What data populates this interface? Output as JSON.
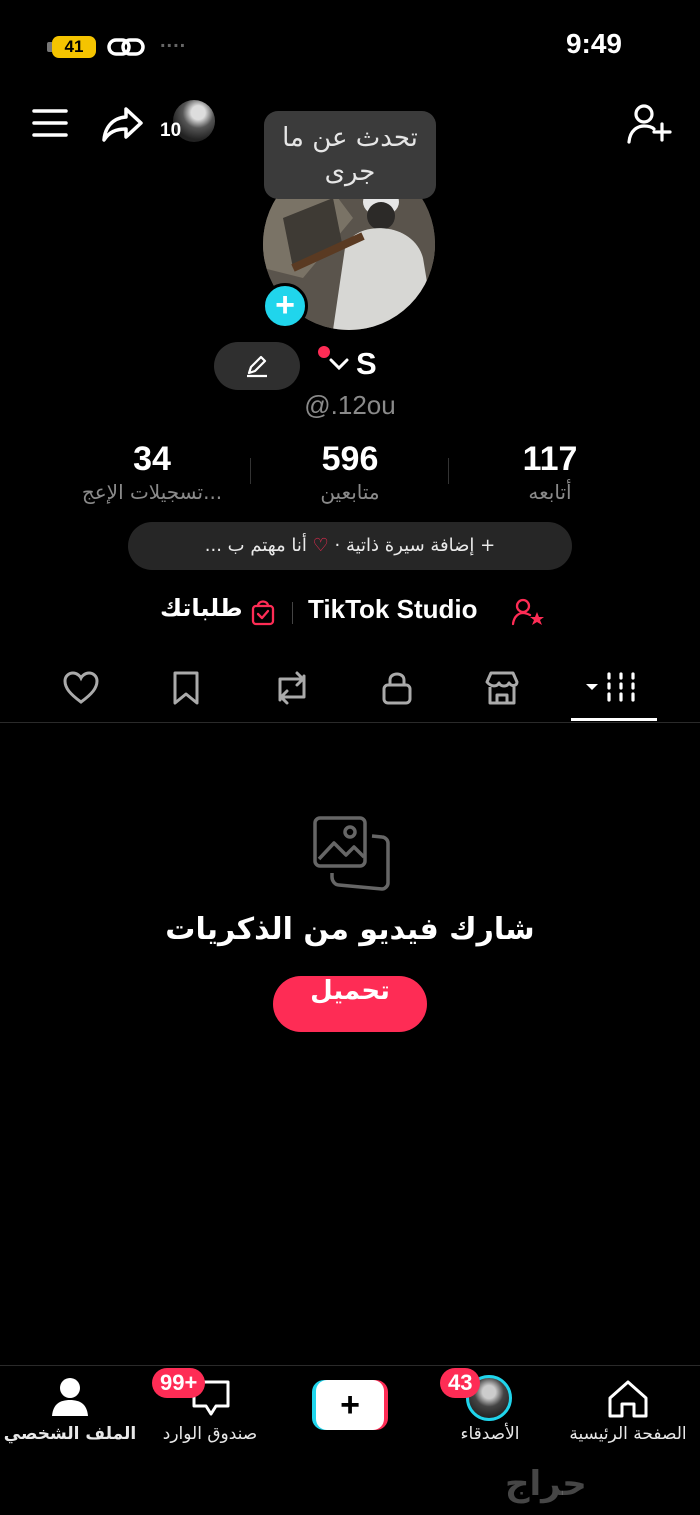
{
  "status_bar": {
    "battery": "41",
    "signal": "....",
    "time": "9:49"
  },
  "top_bar": {
    "story_count": "10"
  },
  "profile": {
    "speech_bubble": [
      "تحدث عن ما",
      "جرى"
    ],
    "avatar_plus": "+",
    "name": "S",
    "handle": "@.12ou"
  },
  "stats": [
    {
      "value": "117",
      "label": "أتابعه"
    },
    {
      "value": "596",
      "label": "متابعين"
    },
    {
      "value": "34",
      "label": "تسجيلات الإعج..."
    }
  ],
  "bio": {
    "add_bio": "+ إضافة سيرة ذاتية",
    "separator": "·",
    "interests": "أنا مهتم ب ..."
  },
  "links": {
    "studio": "TikTok Studio",
    "orders": "طلباتك"
  },
  "tabs": [
    "videos",
    "shop",
    "private",
    "reposts",
    "favorites",
    "liked"
  ],
  "empty_state": {
    "title": "شارك فيديو من الذكريات",
    "button": "تحميل"
  },
  "bottom_nav": {
    "home": "الصفحة الرئيسية",
    "friends": "الأصدقاء",
    "friends_badge": "43",
    "create": "+",
    "inbox": "صندوق الوارد",
    "inbox_badge": "99+",
    "profile": "الملف الشخصي"
  },
  "watermark": "حراج",
  "colors": {
    "accent": "#fe2c55",
    "cyan": "#20d5ec",
    "background": "#000000",
    "muted": "#8a8a8a"
  }
}
